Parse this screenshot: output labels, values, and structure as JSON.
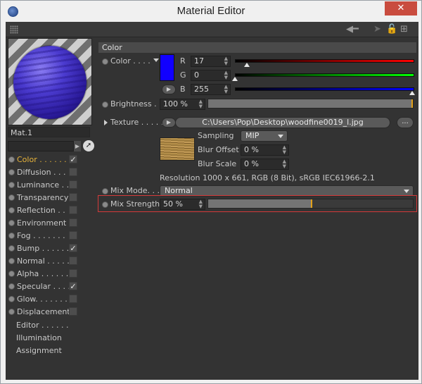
{
  "window": {
    "title": "Material Editor",
    "close_glyph": "✕"
  },
  "toolbar": {
    "icons": [
      "back-arrow-icon",
      "pointer-icon",
      "lock-icon",
      "new-window-icon"
    ]
  },
  "material": {
    "name": "Mat.1"
  },
  "channels": [
    {
      "label": "Color . . . . . .",
      "checked": true,
      "active": true
    },
    {
      "label": "Diffusion . . .",
      "checked": false,
      "active": false
    },
    {
      "label": "Luminance . .",
      "checked": false,
      "active": false
    },
    {
      "label": "Transparency",
      "checked": false,
      "active": false
    },
    {
      "label": "Reflection  . .",
      "checked": false,
      "active": false
    },
    {
      "label": "Environment",
      "checked": false,
      "active": false
    },
    {
      "label": "Fog . . . . . . .",
      "checked": false,
      "active": false
    },
    {
      "label": "Bump . . . . . .",
      "checked": true,
      "active": false
    },
    {
      "label": "Normal . . . . .",
      "checked": false,
      "active": false
    },
    {
      "label": "Alpha . . . . . .",
      "checked": false,
      "active": false
    },
    {
      "label": "Specular . . . .",
      "checked": true,
      "active": false
    },
    {
      "label": "Glow. . . . . . .",
      "checked": false,
      "active": false
    },
    {
      "label": "Displacement",
      "checked": false,
      "active": false
    }
  ],
  "extra_items": [
    "Editor . . . . . .",
    "Illumination",
    "Assignment"
  ],
  "color_section": {
    "header": "Color",
    "color_label": "Color . . . .",
    "swatch_hex": "#1100ff",
    "r_label": "R",
    "r_value": "17",
    "g_label": "G",
    "g_value": "0",
    "b_label": "B",
    "b_value": "255",
    "brightness_label": "Brightness . .",
    "brightness_value": "100 %",
    "texture_label": "Texture . . . . .",
    "texture_path": "C:\\Users\\Pop\\Desktop\\woodfine0019_l.jpg",
    "dots_label": "...",
    "sampling_label": "Sampling",
    "sampling_value": "MIP",
    "blur_offset_label": "Blur Offset",
    "blur_offset_value": "0 %",
    "blur_scale_label": "Blur Scale",
    "blur_scale_value": "0 %",
    "resolution_text": "Resolution 1000 x 661, RGB (8 Bit), sRGB IEC61966-2.1",
    "mix_mode_label": "Mix Mode. . .",
    "mix_mode_value": "Normal",
    "mix_strength_label": "Mix Strength",
    "mix_strength_value": "50 %"
  }
}
